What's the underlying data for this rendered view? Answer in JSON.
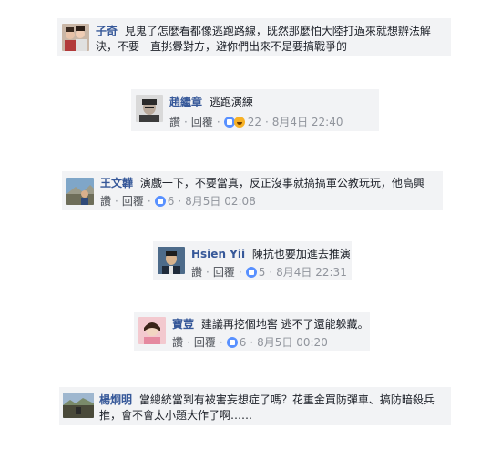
{
  "comments": [
    {
      "name": "子奇",
      "text_line1": "見鬼了怎麼看都像逃跑路線，既然那麼怕大陸打過來就想辦法解",
      "text_line2": "決，不要一直挑釁對方，避你們出來不是要搞戰爭的"
    },
    {
      "name": "趙繼章",
      "text": "逃跑演練",
      "like": "讚",
      "reply": "回覆",
      "reaction_count": "22",
      "time": "8月4日 22:40"
    },
    {
      "name": "王文韡",
      "text": "演戲一下，不要當真，反正沒事就搞搞軍公教玩玩，他高興",
      "like": "讚",
      "reply": "回覆",
      "reaction_count": "6",
      "time": "8月5日 02:08"
    },
    {
      "name": "Hsien Yii",
      "text": "陳抗也要加進去推演",
      "like": "讚",
      "reply": "回覆",
      "reaction_count": "5",
      "time": "8月4日 22:31"
    },
    {
      "name": "寶荳",
      "text": "建議再挖個地窖 逃不了還能躲藏。",
      "like": "讚",
      "reply": "回覆",
      "reaction_count": "6",
      "time": "8月5日 00:20"
    },
    {
      "name": "楊炯明",
      "text_line1": "當總統當到有被害妄想症了嗎？花重金買防彈車、搞防暗殺兵",
      "text_line2": "推，會不會太小題大作了啊……"
    }
  ]
}
